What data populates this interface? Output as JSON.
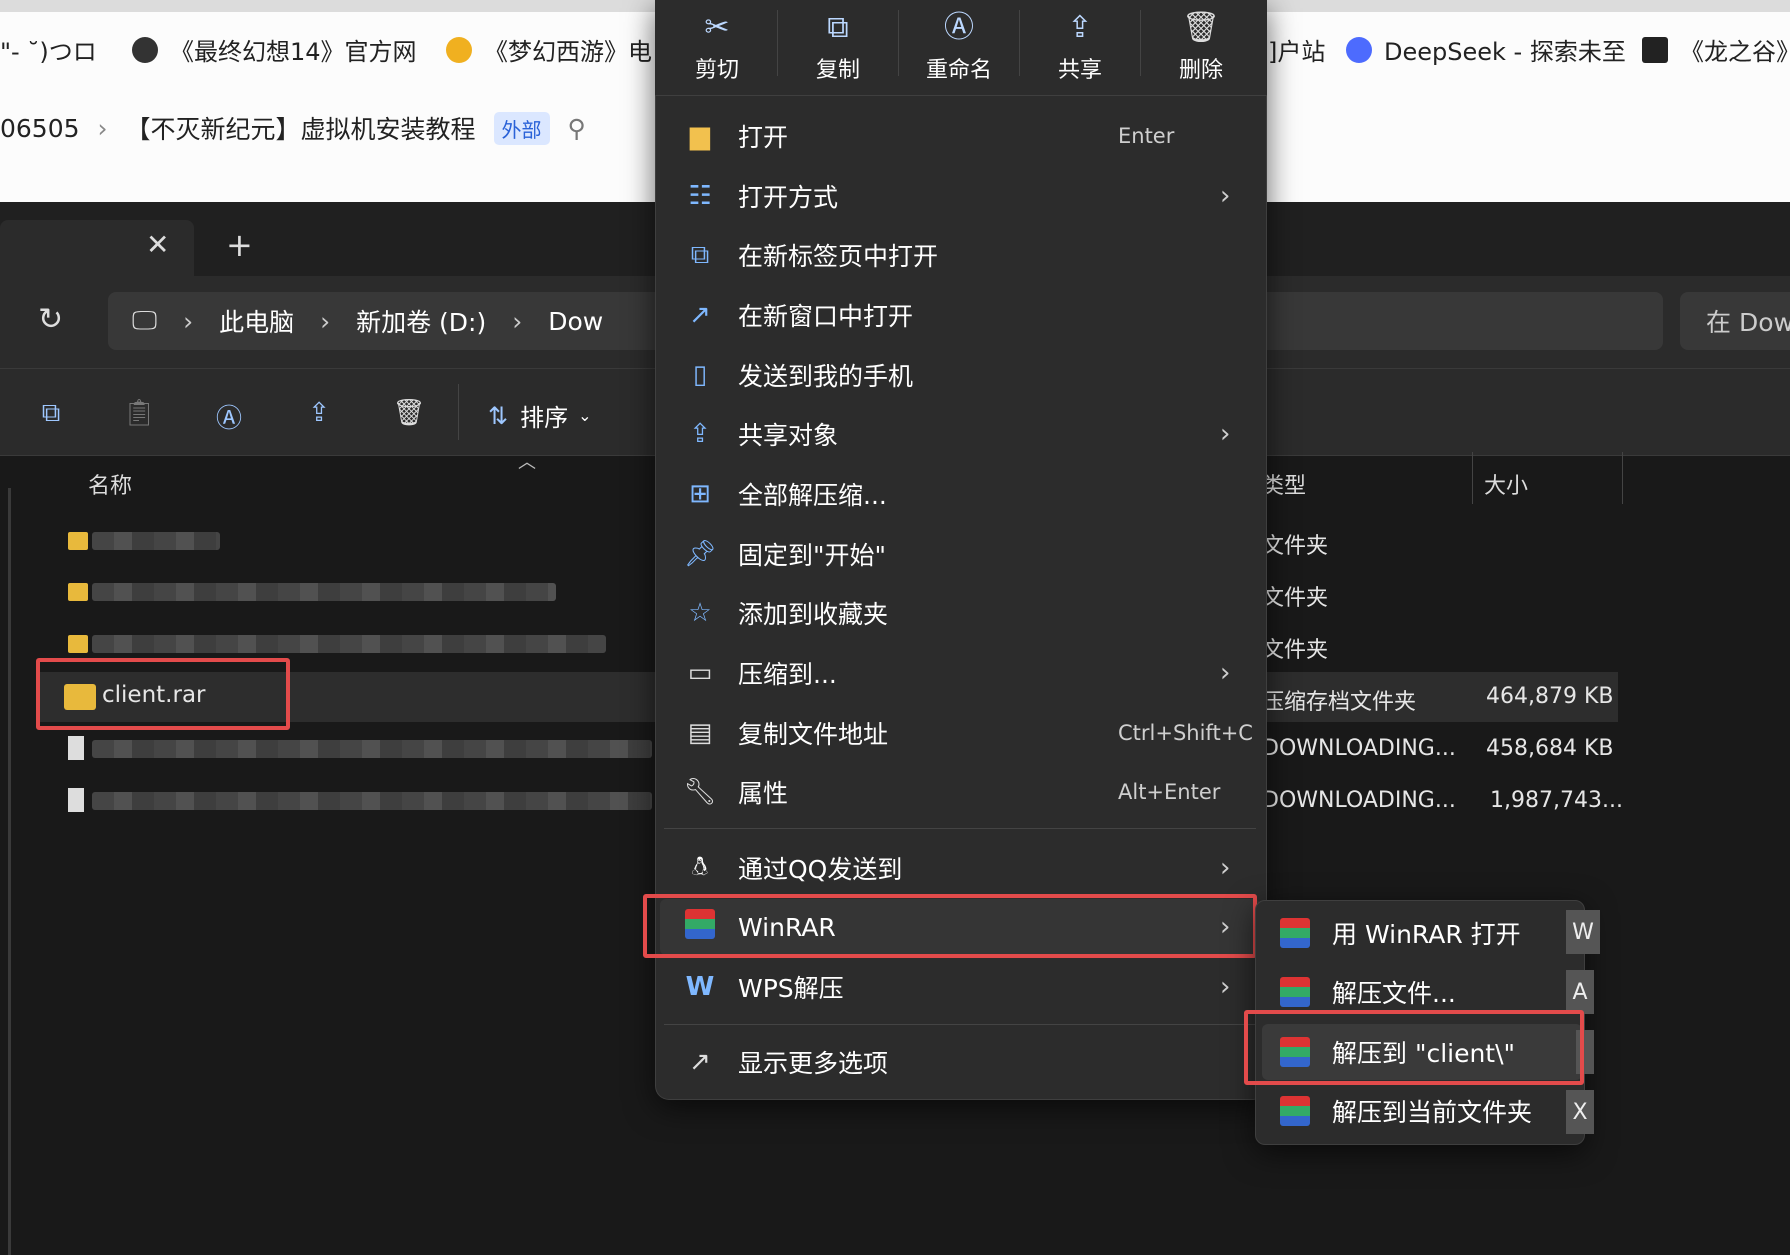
{
  "bookmarks": [
    {
      "label": "\"- ˘)つロ"
    },
    {
      "label": "《最终幻想14》官方网"
    },
    {
      "label": "《梦幻西游》电"
    },
    {
      "label": "]户站"
    },
    {
      "label": "DeepSeek - 探索未至"
    },
    {
      "label": "《龙之谷》"
    }
  ],
  "doc_breadcrumb": {
    "prefix": "06505",
    "title": "【不灭新纪元】虚拟机安装教程",
    "tag": "外部"
  },
  "explorer": {
    "path": [
      "此电脑",
      "新加卷 (D:)",
      "Dow"
    ],
    "search_placeholder": "在 Dow",
    "sort_label": "排序",
    "columns": {
      "name": "名称",
      "type": "类型",
      "size": "大小"
    },
    "rows": [
      {
        "name": "",
        "type": "文件夹",
        "size": ""
      },
      {
        "name": "",
        "type": "文件夹",
        "size": ""
      },
      {
        "name": "",
        "type": "文件夹",
        "size": ""
      },
      {
        "name": "client.rar",
        "type": "压缩存档文件夹",
        "size": "464,879 KB"
      },
      {
        "name": "",
        "type": "DOWNLOADING...",
        "size": "458,684 KB"
      },
      {
        "name": "",
        "type": "DOWNLOADING...",
        "size": "1,987,743..."
      }
    ]
  },
  "context_menu": {
    "quick_actions": [
      {
        "label": "剪切",
        "icon": "scissors-icon"
      },
      {
        "label": "复制",
        "icon": "copy-icon"
      },
      {
        "label": "重命名",
        "icon": "rename-icon"
      },
      {
        "label": "共享",
        "icon": "share-icon"
      },
      {
        "label": "删除",
        "icon": "trash-icon"
      }
    ],
    "items": [
      {
        "label": "打开",
        "shortcut": "Enter"
      },
      {
        "label": "打开方式",
        "shortcut": ""
      },
      {
        "label": "在新标签页中打开",
        "shortcut": ""
      },
      {
        "label": "在新窗口中打开",
        "shortcut": ""
      },
      {
        "label": "发送到我的手机",
        "shortcut": ""
      },
      {
        "label": "共享对象",
        "shortcut": ""
      },
      {
        "label": "全部解压缩...",
        "shortcut": ""
      },
      {
        "label": "固定到\"开始\"",
        "shortcut": ""
      },
      {
        "label": "添加到收藏夹",
        "shortcut": ""
      },
      {
        "label": "压缩到...",
        "shortcut": ""
      },
      {
        "label": "复制文件地址",
        "shortcut": "Ctrl+Shift+C"
      },
      {
        "label": "属性",
        "shortcut": "Alt+Enter"
      },
      {
        "label": "通过QQ发送到",
        "shortcut": ""
      },
      {
        "label": "WinRAR",
        "shortcut": ""
      },
      {
        "label": "WPS解压",
        "shortcut": ""
      },
      {
        "label": "显示更多选项",
        "shortcut": ""
      }
    ]
  },
  "winrar_submenu": [
    {
      "label": "用 WinRAR 打开",
      "key": "W"
    },
    {
      "label": "解压文件...",
      "key": "A"
    },
    {
      "label": "解压到 \"client\\\"",
      "key": ""
    },
    {
      "label": "解压到当前文件夹",
      "key": "X"
    }
  ],
  "colors": {
    "highlight": "#e34b4b",
    "accent": "#7fb8ff"
  }
}
